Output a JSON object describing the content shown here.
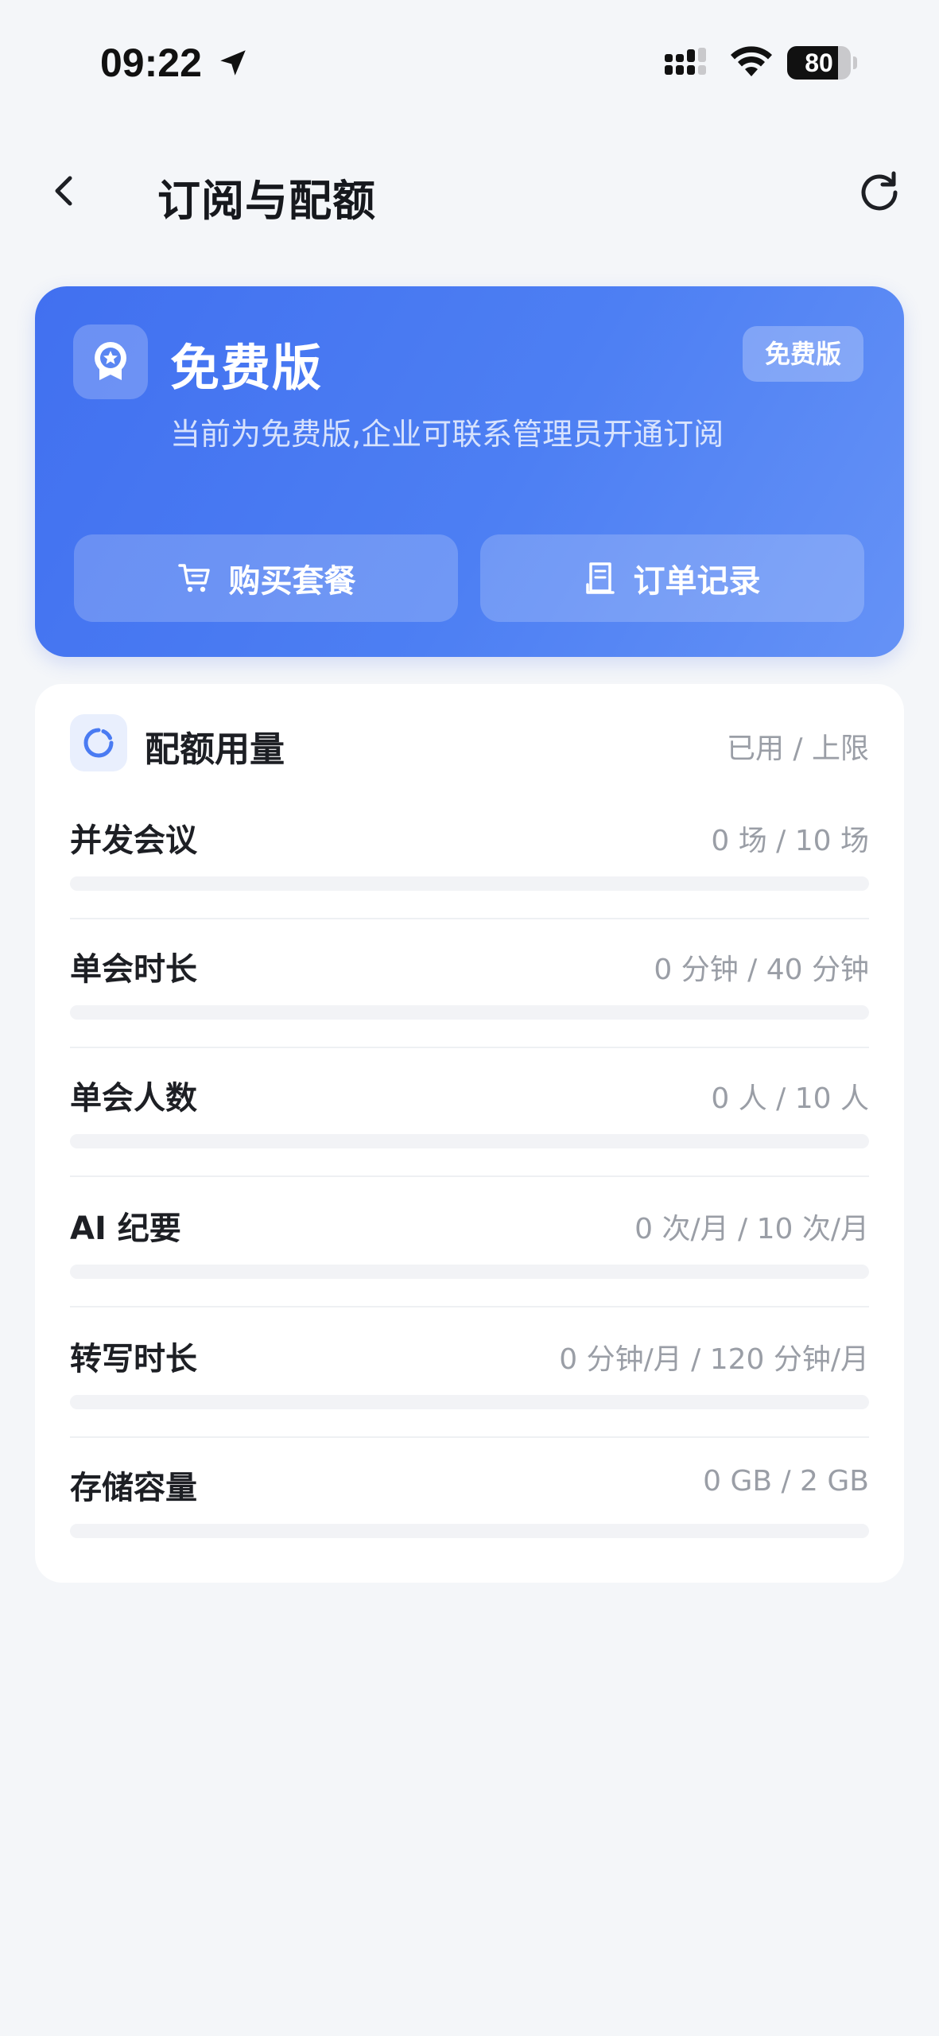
{
  "status_bar": {
    "time": "09:22",
    "battery": "80",
    "battery_level": 0.8,
    "icons": [
      "location-arrow-icon",
      "cellular-signal-icon",
      "wifi-icon",
      "battery-icon"
    ]
  },
  "nav": {
    "title": "订阅与配额",
    "back_icon": "chevron-left-icon",
    "refresh_icon": "refresh-icon"
  },
  "plan": {
    "name": "免费版",
    "badge": "免费版",
    "description": "当前为免费版,企业可联系管理员开通订阅",
    "icon": "award-ribbon-icon",
    "buy_label": "购买套餐",
    "buy_icon": "cart-icon",
    "orders_label": "订单记录",
    "orders_icon": "receipt-icon"
  },
  "colors": {
    "accent": "#4a7bf2",
    "card_gradient_start": "#4170f0",
    "card_gradient_end": "#6592f6",
    "page_bg": "#f4f6f9",
    "muted_text": "#9a9ea6"
  },
  "quota": {
    "title": "配额用量",
    "legend": "已用 / 上限",
    "icon": "usage-ring-icon",
    "items": [
      {
        "label": "并发会议",
        "value": "0 场 / 10 场",
        "used_fraction": 0
      },
      {
        "label": "单会时长",
        "value": "0 分钟 / 40 分钟",
        "used_fraction": 0
      },
      {
        "label": "单会人数",
        "value": "0 人 / 10 人",
        "used_fraction": 0
      },
      {
        "label": "AI 纪要",
        "value": "0 次/月 / 10 次/月",
        "used_fraction": 0
      },
      {
        "label": "转写时长",
        "value": "0 分钟/月 / 120 分钟/月",
        "used_fraction": 0
      },
      {
        "label": "存储容量",
        "value": "0 GB / 2 GB",
        "used_fraction": 0
      }
    ]
  }
}
